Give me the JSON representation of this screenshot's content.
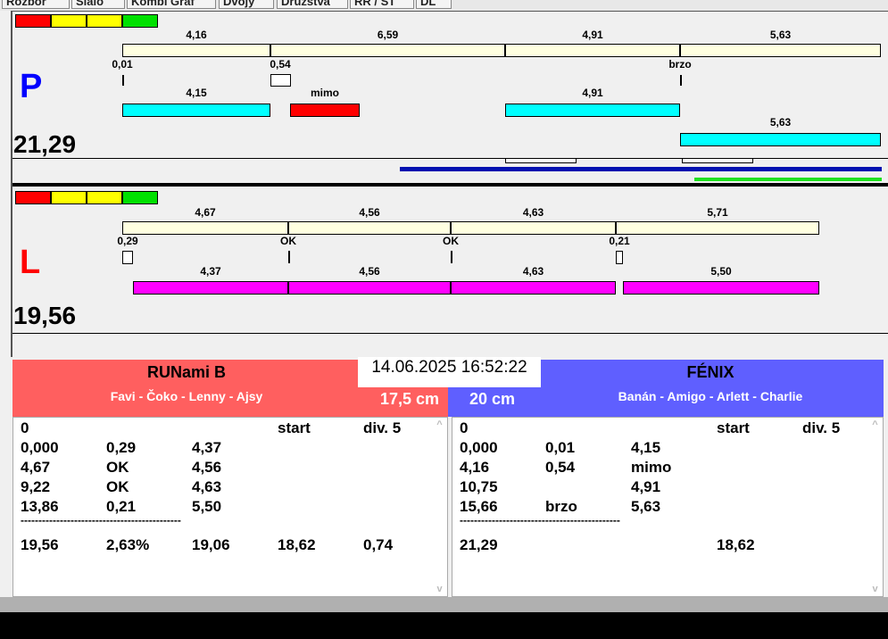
{
  "tabs": [
    "Rozbor",
    "Slalo",
    "Kombi Graf",
    "Dvojy",
    "Družstvá",
    "RR / ST",
    "DL"
  ],
  "colors": {
    "red": "#ff0000",
    "yellow": "#ffff00",
    "green": "#00e000",
    "cyan": "#00ffff",
    "magenta": "#ff00ff",
    "track": "#ffffe0",
    "left_team": "#ff5f5f",
    "right_team": "#5f5fff"
  },
  "P": {
    "letter": "P",
    "total": "21,29",
    "top_labels": [
      "4,16",
      "6,59",
      "4,91",
      "5,63"
    ],
    "marks": [
      "0,01",
      "0,54",
      "brzo"
    ],
    "bar_labels": [
      "4,15",
      "mimo",
      "4,91",
      "5,63"
    ]
  },
  "L": {
    "letter": "L",
    "total": "19,56",
    "top_labels": [
      "4,67",
      "4,56",
      "4,63",
      "5,71"
    ],
    "marks": [
      "0,29",
      "OK",
      "OK",
      "0,21"
    ],
    "bar_labels": [
      "4,37",
      "4,56",
      "4,63",
      "5,50"
    ]
  },
  "datetime": "14.06.2025 16:52:22",
  "left_team": {
    "name": "RUNami B",
    "dogs": "Favi - Čoko - Lenny - Ajsy",
    "height": "17,5 cm",
    "rows": [
      [
        "0",
        "",
        "",
        "start",
        "div. 5"
      ],
      [
        "0,000",
        "0,29",
        "4,37",
        "",
        ""
      ],
      [
        "4,67",
        "OK",
        "4,56",
        "",
        ""
      ],
      [
        "9,22",
        "OK",
        "4,63",
        "",
        ""
      ],
      [
        "13,86",
        "0,21",
        "5,50",
        "",
        ""
      ]
    ],
    "separator": "---------------------------------------------",
    "summary": [
      "19,56",
      "2,63%",
      "19,06",
      "18,62",
      "0,74"
    ]
  },
  "right_team": {
    "name": "FÉNIX",
    "dogs": "Banán - Amigo - Arlett - Charlie",
    "height": "20 cm",
    "rows": [
      [
        "0",
        "",
        "",
        "start",
        "div. 5"
      ],
      [
        "0,000",
        "0,01",
        "4,15",
        "",
        ""
      ],
      [
        "4,16",
        "0,54",
        "mimo",
        "",
        ""
      ],
      [
        "10,75",
        "",
        "4,91",
        "",
        ""
      ],
      [
        "15,66",
        "brzo",
        "5,63",
        "",
        ""
      ]
    ],
    "separator": "---------------------------------------------",
    "summary": [
      "21,29",
      "",
      "",
      "18,62",
      ""
    ]
  }
}
